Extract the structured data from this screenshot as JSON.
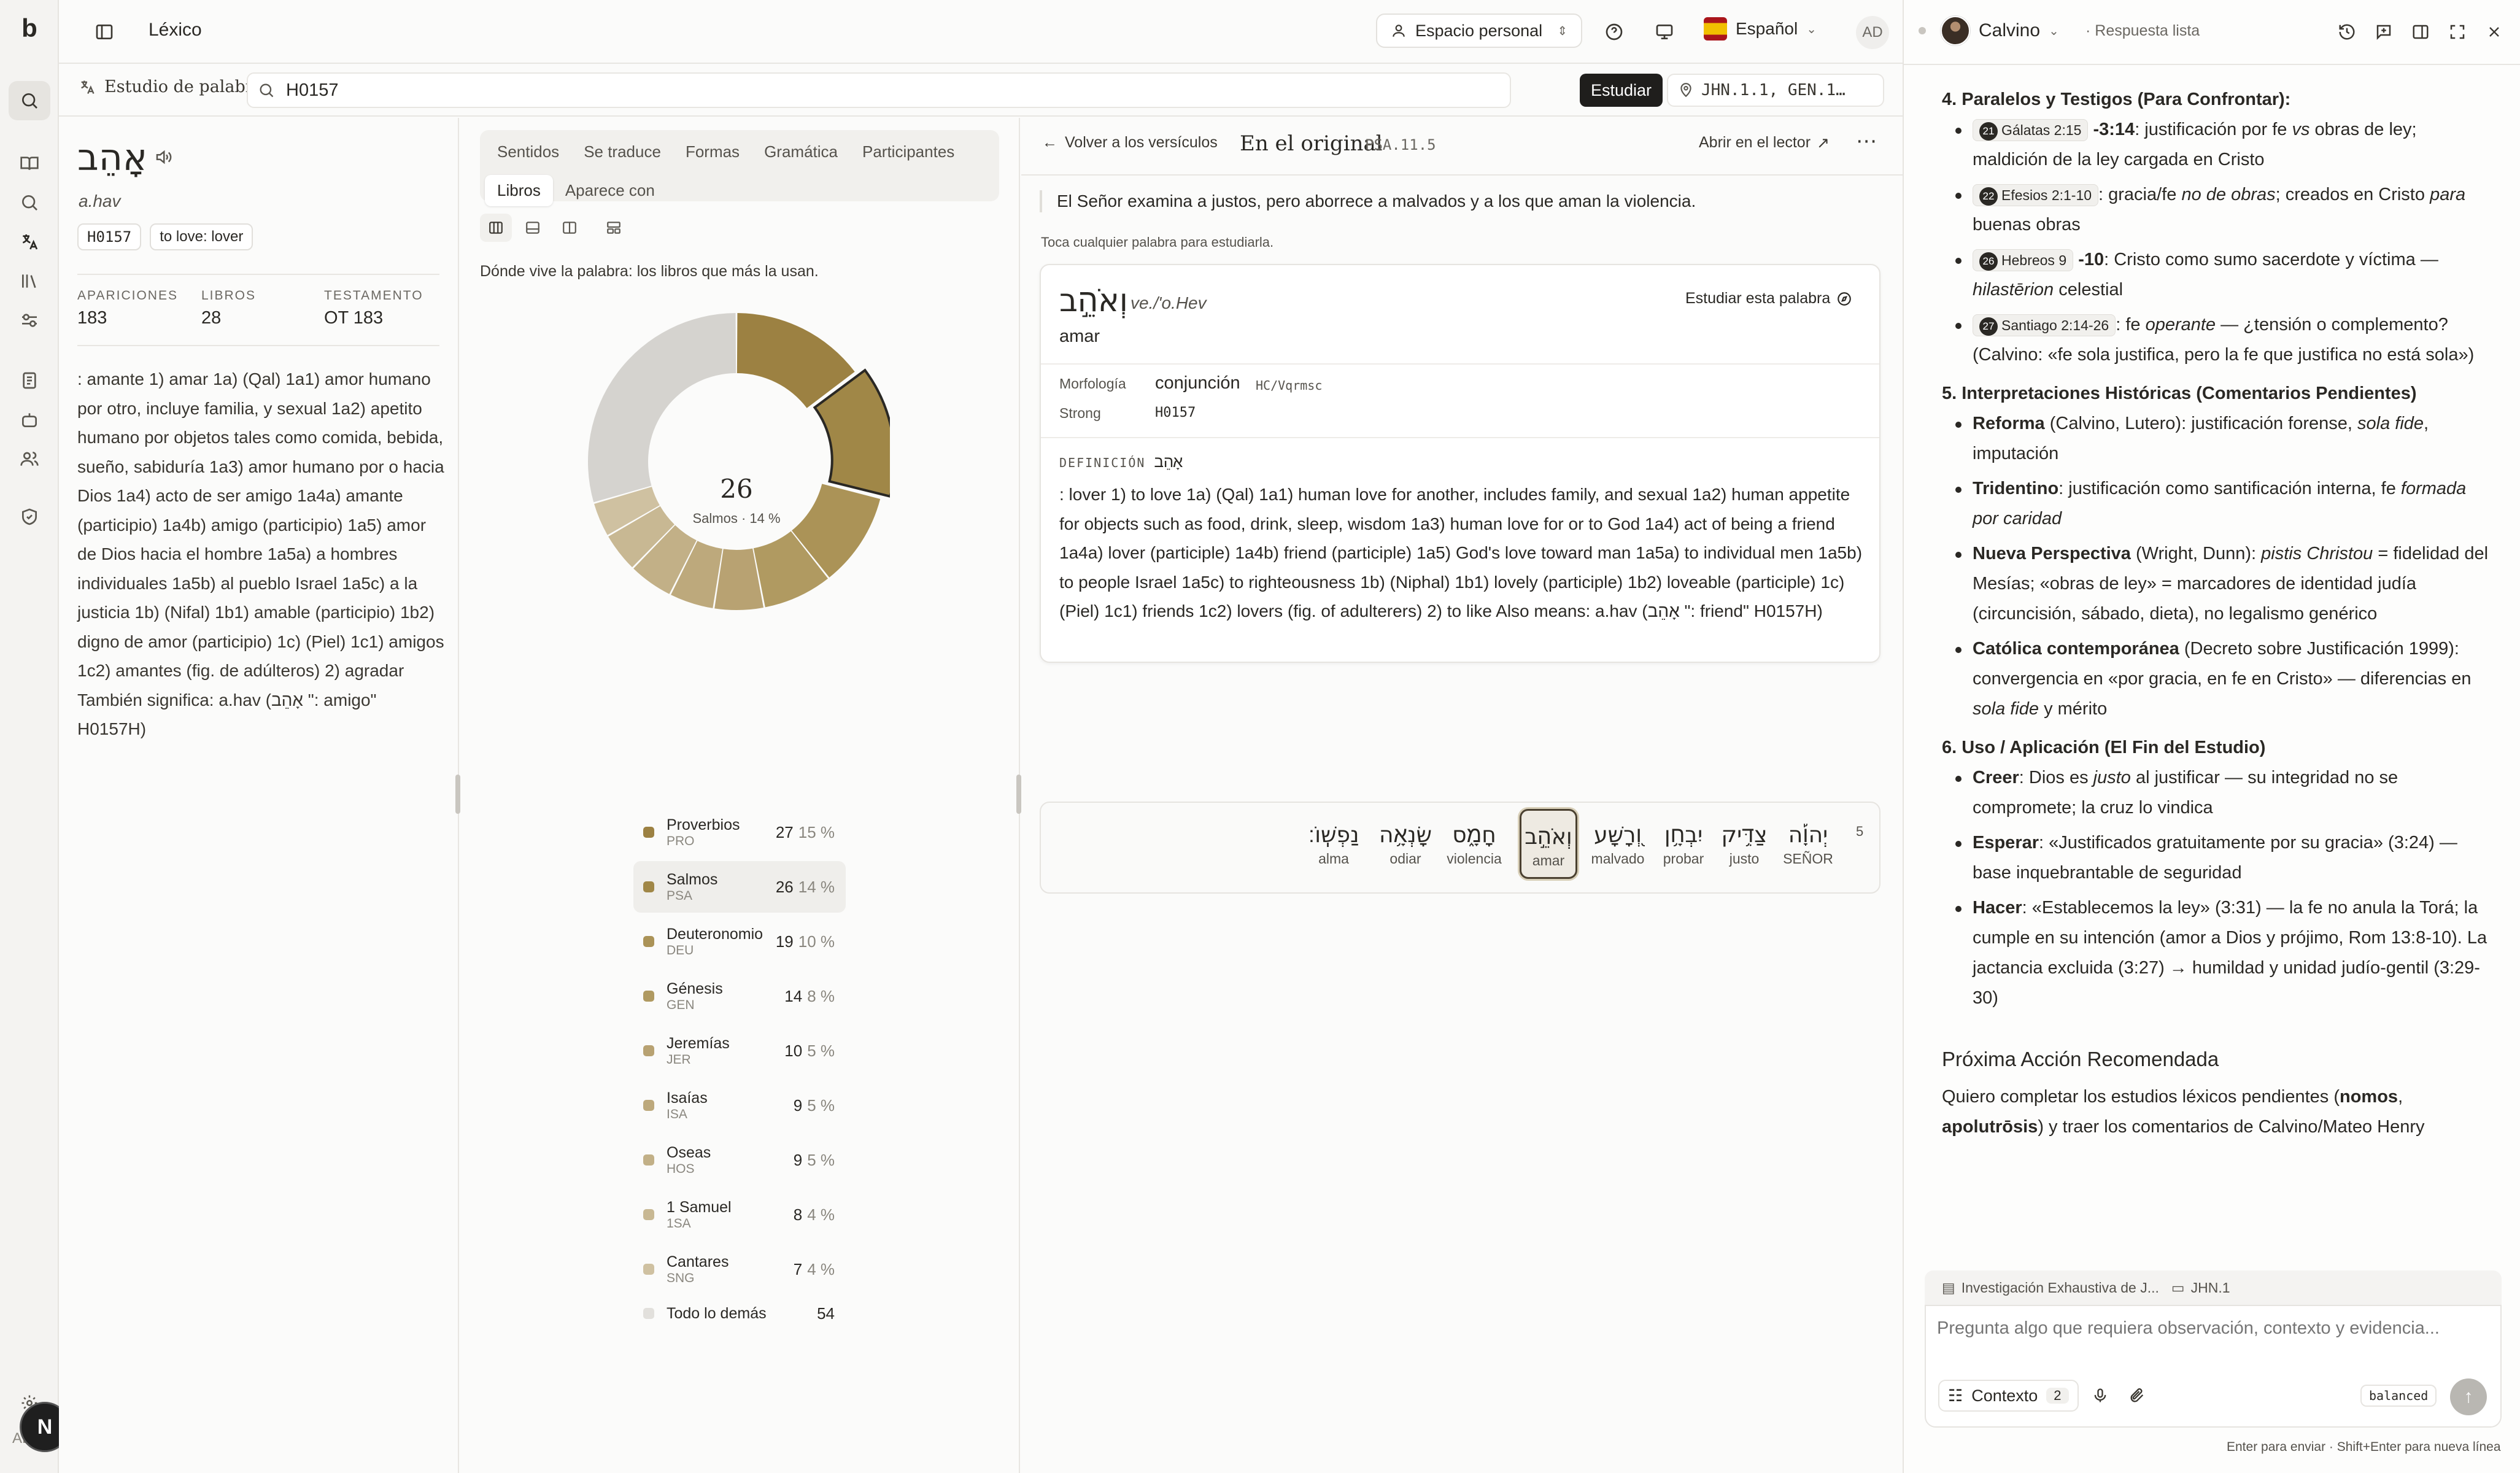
{
  "app": {
    "logo": "b",
    "title": "Léxico"
  },
  "topbar": {
    "workspace": "Espacio personal",
    "language": "Español",
    "avatar": "AD"
  },
  "search": {
    "tool_label": "Estudio de palabras",
    "query": "H0157",
    "study_button": "Estudiar",
    "location": "JHN.1.1, GEN.1…"
  },
  "word": {
    "hebrew": "אָהֵב",
    "translit": "a.hav",
    "strong": "H0157",
    "gloss": "to love: lover",
    "stats": [
      {
        "label": "APARICIONES",
        "value": "183"
      },
      {
        "label": "LIBROS",
        "value": "28"
      },
      {
        "label": "TESTAMENTO",
        "value": "OT 183"
      }
    ],
    "definition": ": amante 1) amar 1a) (Qal) 1a1) amor humano por otro, incluye familia, y sexual 1a2) apetito humano por objetos tales como comida, bebida, sueño, sabiduría 1a3) amor humano por o hacia Dios 1a4) acto de ser amigo 1a4a) amante (participio) 1a4b) amigo (participio) 1a5) amor de Dios hacia el hombre 1a5a) a hombres individuales 1a5b) al pueblo Israel 1a5c) a la justicia 1b) (Nifal) 1b1) amable (participio) 1b2) digno de amor (participio) 1c) (Piel) 1c1) amigos 1c2) amantes (fig. de adúlteros) 2) agradar También significa: a.hav (אָהֵב \": amigo\" H0157H)"
  },
  "analysis": {
    "tabs": [
      "Sentidos",
      "Se traduce",
      "Formas",
      "Gramática",
      "Participantes",
      "Libros",
      "Aparece con"
    ],
    "active_tab": "Libros",
    "caption": "Dónde vive la palabra: los libros que más la usan.",
    "center_value": "26",
    "center_label": "Salmos · 14 %"
  },
  "chart_data": {
    "type": "pie",
    "categories": [
      "Proverbios",
      "Salmos",
      "Deuteronomio",
      "Génesis",
      "Jeremías",
      "Isaías",
      "Oseas",
      "1 Samuel",
      "Cantares",
      "Todo lo demás"
    ],
    "abbrevs": [
      "PRO",
      "PSA",
      "DEU",
      "GEN",
      "JER",
      "ISA",
      "HOS",
      "1SA",
      "SNG",
      ""
    ],
    "values": [
      27,
      26,
      19,
      14,
      10,
      9,
      9,
      8,
      7,
      54
    ],
    "percents": [
      "15 %",
      "14 %",
      "10 %",
      "8 %",
      "5 %",
      "5 %",
      "5 %",
      "4 %",
      "4 %",
      ""
    ],
    "colors": [
      "#9c8142",
      "#a08747",
      "#ab9357",
      "#b09a61",
      "#b8a272",
      "#bda97c",
      "#c2b087",
      "#c8b893",
      "#cfc1a1",
      "#d5d3cf"
    ],
    "selected": "Salmos"
  },
  "verse": {
    "back_label": "Volver a los versículos",
    "title": "En el original",
    "ref": "PSA.11.5",
    "open_reader": "Abrir en el lector",
    "text": "El Señor examina a justos, pero aborrece a malvados y a los que aman la violencia.",
    "hint": "Toca cualquier palabra para estudiarla.",
    "card": {
      "hebrew": "וְאֹהֵ֣ב",
      "translit": "ve./'o.Hev",
      "gloss": "amar",
      "study_btn": "Estudiar esta palabra",
      "morph_label": "Morfología",
      "morph_value": "conjunción",
      "morph_code": "HC/Vqrmsc",
      "strong_label": "Strong",
      "strong_value": "H0157",
      "def_label": "DEFINICIÓN",
      "def_hebrew": "אָהֵב",
      "definition": ": lover 1) to love 1a) (Qal) 1a1) human love for another, includes family, and sexual 1a2) human appetite for objects such as food, drink, sleep, wisdom 1a3) human love for or to God 1a4) act of being a friend 1a4a) lover (participle) 1a4b) friend (participle) 1a5) God's love toward man 1a5a) to individual men 1a5b) to people Israel 1a5c) to righteousness 1b) (Niphal) 1b1) lovely (participle) 1b2) loveable (participle) 1c) (Piel) 1c1) friends 1c2) lovers (fig. of adulterers) 2) to like Also means: a.hav (אָהֵב \": friend\" H0157H)"
    },
    "verse_num": "5",
    "words": [
      {
        "he": "נַפְשֽׁוֹ׃",
        "gl": "alma"
      },
      {
        "he": "שָׂנְאָ֥ה",
        "gl": "odiar"
      },
      {
        "he": "חָמָ֑ס",
        "gl": "violencia"
      },
      {
        "he": "וְאֹהֵ֣ב",
        "gl": "amar"
      },
      {
        "he": "וְ֭רָשָׁע",
        "gl": "malvado"
      },
      {
        "he": "יִבְחָ֥ן",
        "gl": "probar"
      },
      {
        "he": "צַדִּ֥יק",
        "gl": "justo"
      },
      {
        "he": "יְהוָ֡ה",
        "gl": "SEÑOR"
      }
    ]
  },
  "chat": {
    "model": "Calvino",
    "status": "· Respuesta lista",
    "sections": [
      {
        "title": "4. Paralelos y Testigos (Para Confrontar):",
        "items": [
          {
            "num": "21",
            "ref": "Gálatas 2:15",
            "extra": "-3:14",
            "text": ": justificación por fe vs obras de ley; maldición de la ley cargada en Cristo"
          },
          {
            "num": "22",
            "ref": "Efesios 2:1-10",
            "extra": "",
            "text": ": gracia/fe no de obras; creados en Cristo para buenas obras"
          },
          {
            "num": "26",
            "ref": "Hebreos 9",
            "extra": "-10",
            "text": ": Cristo como sumo sacerdote y víctima — hilastērion celestial"
          },
          {
            "num": "27",
            "ref": "Santiago 2:14-26",
            "extra": "",
            "text": ": fe operante — ¿tensión o complemento? (Calvino: «fe sola justifica, pero la fe que justifica no está sola»)"
          }
        ]
      },
      {
        "title": "5. Interpretaciones Históricas (Comentarios Pendientes)",
        "items": [
          {
            "bold": "Reforma",
            "text": " (Calvino, Lutero): justificación forense, sola fide, imputación"
          },
          {
            "bold": "Tridentino",
            "text": ": justificación como santificación interna, fe formada por caridad"
          },
          {
            "bold": "Nueva Perspectiva",
            "text": " (Wright, Dunn): pistis Christou = fidelidad del Mesías; «obras de ley» = marcadores de identidad judía (circuncisión, sábado, dieta), no legalismo genérico"
          },
          {
            "bold": "Católica contemporánea",
            "text": " (Decreto sobre Justificación 1999): convergencia en «por gracia, en fe en Cristo» — diferencias en sola fide y mérito"
          }
        ]
      },
      {
        "title": "6. Uso / Aplicación (El Fin del Estudio)",
        "items": [
          {
            "bold": "Creer",
            "text": ": Dios es justo al justificar — su integridad no se compromete; la cruz lo vindica"
          },
          {
            "bold": "Esperar",
            "text": ": «Justificados gratuitamente por su gracia» (3:24) — base inquebrantable de seguridad"
          },
          {
            "bold": "Hacer",
            "text": ": «Establecemos la ley» (3:31) — la fe no anula la Torá; la cumple en su intención (amor a Dios y prójimo, Rom 13:8-10). La jactancia excluida (3:27) → humildad y unidad judío-gentil (3:29-30)"
          }
        ]
      }
    ],
    "next_title": "Próxima Acción Recomendada",
    "next_text_a": "Quiero completar los estudios léxicos pendientes (",
    "next_b1": "nomos",
    "next_sep": ", ",
    "next_b2": "apolutrōsis",
    "next_text_b": ") y traer los comentarios de Calvino/Mateo Henry",
    "context_chip1": "Investigación Exhaustiva de J...",
    "context_chip2": "JHN.1",
    "placeholder": "Pregunta algo que requiera observación, contexto y evidencia...",
    "context_label": "Contexto",
    "context_count": "2",
    "mode": "balanced",
    "footer": "Enter para enviar · Shift+Enter para nueva línea",
    "user_initial": "N"
  }
}
